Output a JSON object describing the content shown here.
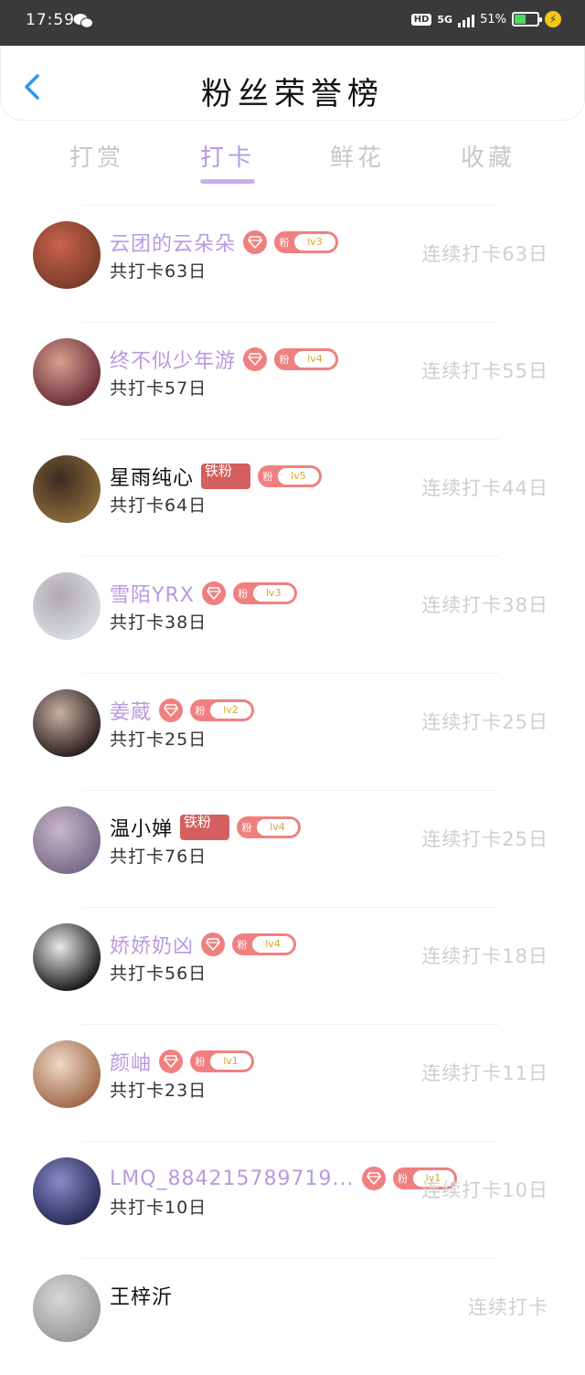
{
  "status": {
    "time": "17:59",
    "hd": "HD",
    "network": "5G",
    "battery_pct": "51%",
    "battery_level": 0.51
  },
  "header": {
    "title": "粉丝荣誉榜"
  },
  "tabs": [
    {
      "label": "打赏",
      "active": false
    },
    {
      "label": "打卡",
      "active": true
    },
    {
      "label": "鲜花",
      "active": false
    },
    {
      "label": "收藏",
      "active": false
    }
  ],
  "colors": {
    "accent": "#b79be0",
    "badge": "#f08080",
    "iron": "#d45f5f",
    "muted": "#cfcfcf"
  },
  "rows": [
    {
      "name": "云团的云朵朵",
      "name_style": "purple",
      "badge": "diamond",
      "level": "lv3",
      "total": "共打卡63日",
      "streak": "连续打卡63日",
      "avatar_colors": [
        "#7a3b2a",
        "#c8644a"
      ]
    },
    {
      "name": "终不似少年游",
      "name_style": "purple",
      "badge": "diamond",
      "level": "lv4",
      "total": "共打卡57日",
      "streak": "连续打卡55日",
      "avatar_colors": [
        "#6b2e3a",
        "#d9a08f"
      ]
    },
    {
      "name": "星雨纯心",
      "name_style": "black",
      "badge": "iron",
      "iron_text": "铁粉",
      "level": "lv5",
      "total": "共打卡64日",
      "streak": "连续打卡44日",
      "avatar_colors": [
        "#8a6a3a",
        "#3a2a20"
      ]
    },
    {
      "name": "雪陌YRX",
      "name_style": "purple",
      "badge": "diamond",
      "level": "lv3",
      "total": "共打卡38日",
      "streak": "连续打卡38日",
      "avatar_colors": [
        "#d8dce0",
        "#b0a8b0"
      ]
    },
    {
      "name": "姜蔵",
      "name_style": "purple",
      "badge": "diamond",
      "level": "lv2",
      "total": "共打卡25日",
      "streak": "连续打卡25日",
      "avatar_colors": [
        "#2a2020",
        "#c8b0a0"
      ]
    },
    {
      "name": "温小婵",
      "name_style": "black",
      "badge": "iron",
      "iron_text": "铁粉",
      "level": "lv4",
      "total": "共打卡76日",
      "streak": "连续打卡25日",
      "avatar_colors": [
        "#7a6a8a",
        "#c8b8c8"
      ]
    },
    {
      "name": "娇娇奶凶",
      "name_style": "purple",
      "badge": "diamond",
      "level": "lv4",
      "total": "共打卡56日",
      "streak": "连续打卡18日",
      "avatar_colors": [
        "#1a1a1a",
        "#e8e8e8"
      ]
    },
    {
      "name": "颜岫",
      "name_style": "purple",
      "badge": "diamond",
      "level": "lv1",
      "total": "共打卡23日",
      "streak": "连续打卡11日",
      "avatar_colors": [
        "#a06a4a",
        "#f0d8c8"
      ]
    },
    {
      "name": "LMQ_884215789719...",
      "name_style": "purple",
      "badge": "diamond",
      "level": "lv1",
      "total": "共打卡10日",
      "streak": "连续打卡10日",
      "avatar_colors": [
        "#2a2a5a",
        "#8a8ac8"
      ]
    },
    {
      "name": "王梓沂",
      "name_style": "black",
      "badge": "none",
      "level": "",
      "total": "",
      "streak": "连续打卡",
      "avatar_colors": [
        "#9a9a9a",
        "#d8d8d8"
      ]
    }
  ]
}
